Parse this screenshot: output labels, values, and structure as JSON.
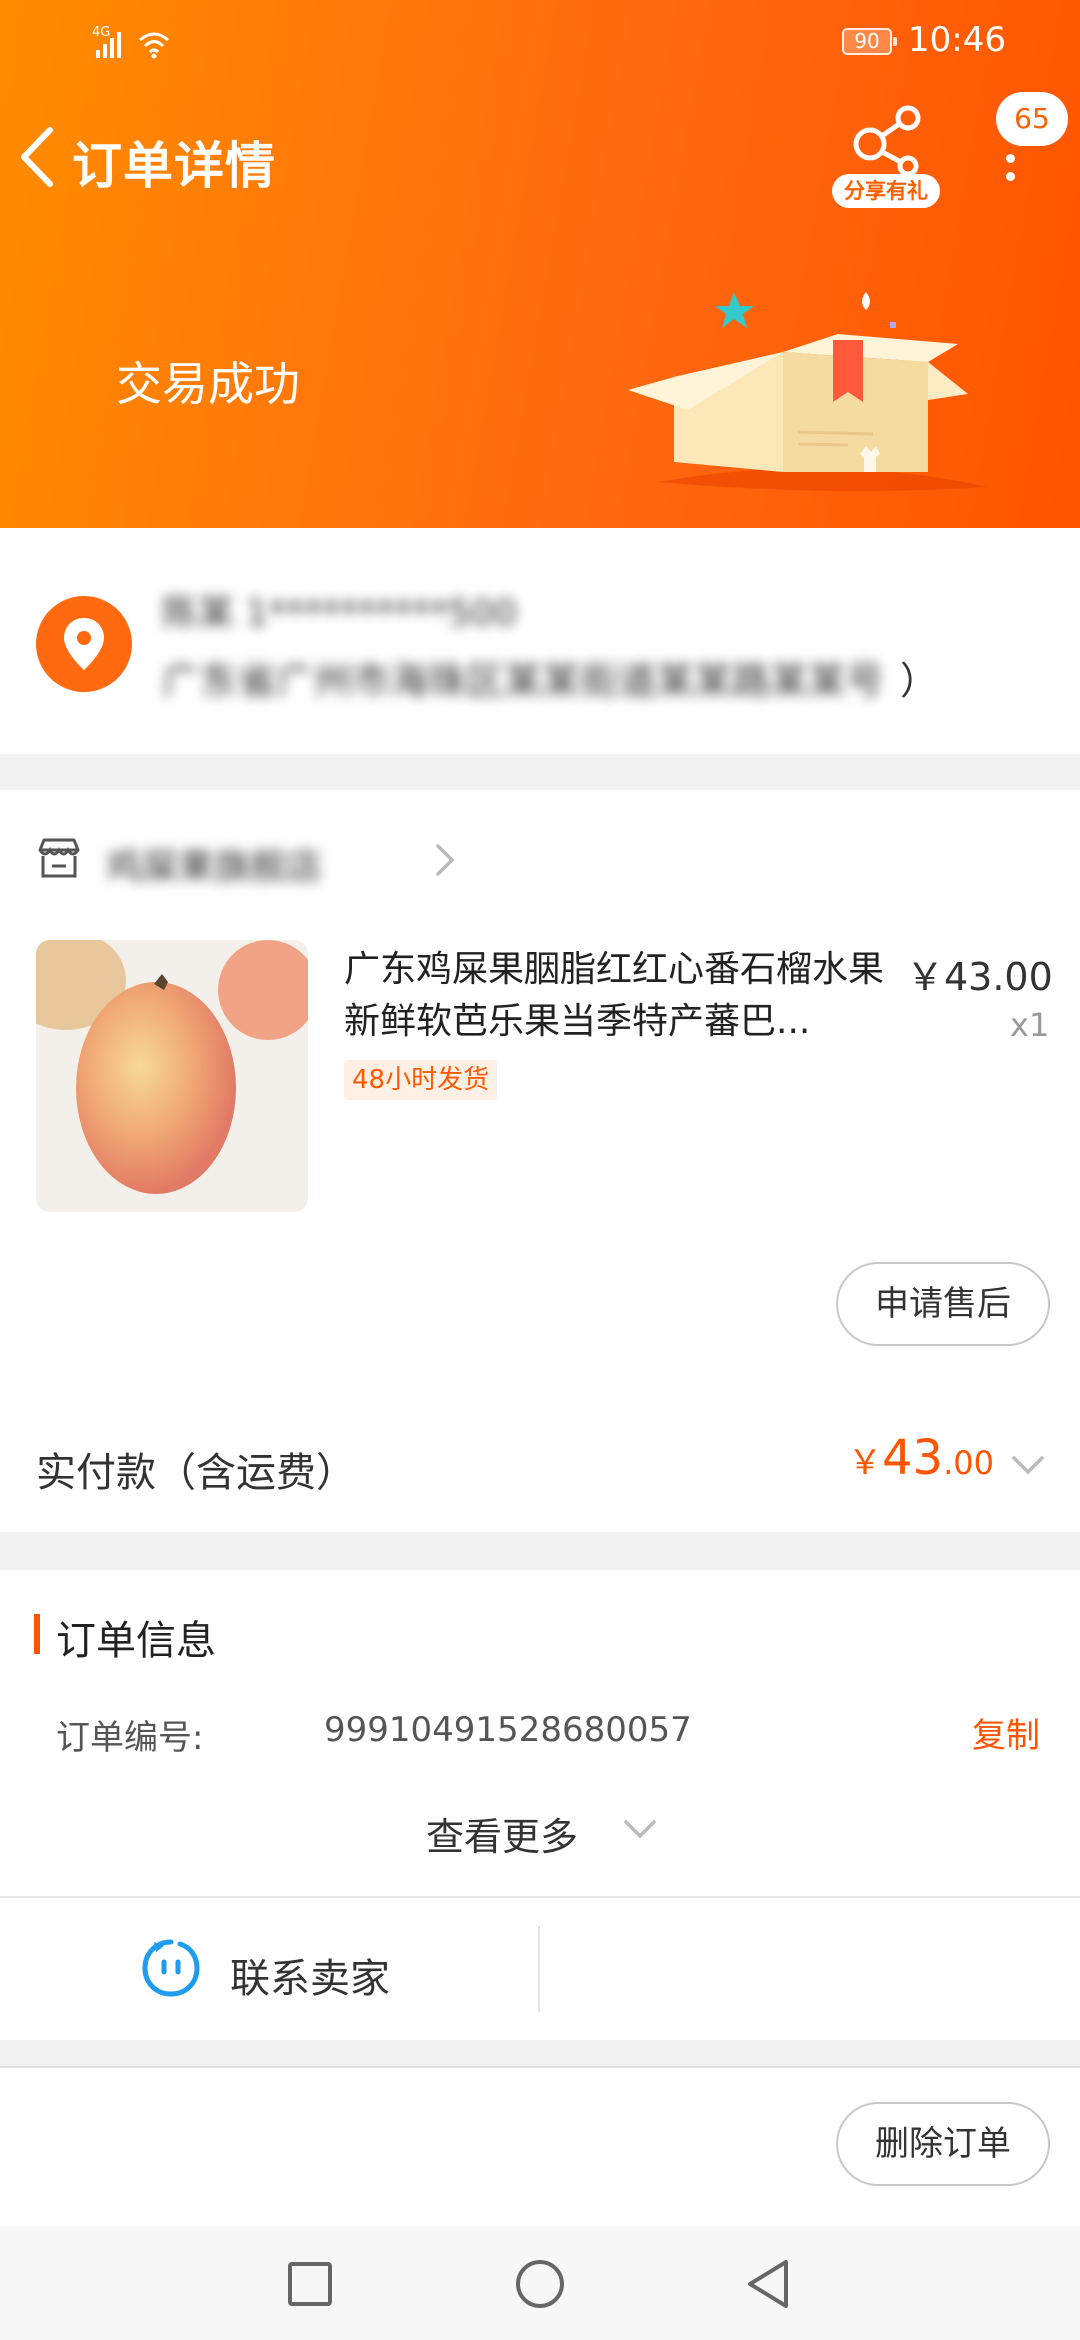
{
  "status_bar": {
    "network": "4G",
    "battery": "90",
    "time": "10:46"
  },
  "header": {
    "title": "订单详情",
    "share_label": "分享有礼",
    "message_count": "65",
    "order_status": "交易成功"
  },
  "address": {
    "name_masked": "陈某 1**********500",
    "detail_masked": "广东省广州市海珠区某某街道某某路某某号",
    "detail_tail": "）"
  },
  "shop": {
    "name_masked": "鸡屎果旗舰店"
  },
  "product": {
    "title": "广东鸡屎果胭脂红红心番石榴水果新鲜软芭乐果当季特产蕃巴...",
    "price": "￥43.00",
    "quantity": "x1",
    "shipping_tag": "48小时发货",
    "aftersale_label": "申请售后"
  },
  "payment": {
    "label": "实付款（含运费）",
    "currency": "￥",
    "amount_integer": "43",
    "amount_decimal": ".00"
  },
  "order_info": {
    "section_title": "订单信息",
    "order_no_label": "订单编号:",
    "order_no_value": "99910491528680057",
    "copy_label": "复制",
    "view_more_label": "查看更多"
  },
  "contact": {
    "label": "联系卖家"
  },
  "actions": {
    "delete_label": "删除订单"
  },
  "colors": {
    "accent": "#ff5500",
    "header_start": "#ff8c00",
    "header_end": "#ff5400",
    "contact_blue": "#1e9cf0"
  },
  "icons": [
    "signal-icon",
    "wifi-icon",
    "back-chevron-icon",
    "share-icon",
    "more-dots-icon",
    "location-pin-icon",
    "shop-icon",
    "chevron-right-icon",
    "chevron-down-icon",
    "chat-face-icon",
    "nav-square-icon",
    "nav-circle-icon",
    "nav-triangle-icon"
  ]
}
